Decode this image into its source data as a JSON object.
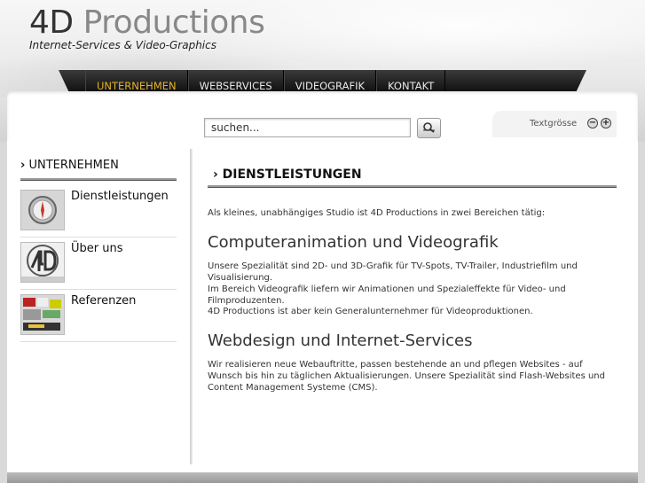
{
  "header": {
    "logo_4d": "4D",
    "logo_productions": "Productions",
    "tagline": "Internet-Services & Video-Graphics"
  },
  "nav": {
    "items": [
      {
        "label": "UNTERNEHMEN",
        "active": true
      },
      {
        "label": "WEBSERVICES"
      },
      {
        "label": "VIDEOGRAFIK"
      },
      {
        "label": "KONTAKT"
      }
    ],
    "active_color": "#e5b52a"
  },
  "search": {
    "value": "suchen...",
    "button_icon": "search-icon"
  },
  "textsize": {
    "label": "Textgrösse",
    "decrease": "−",
    "increase": "+"
  },
  "sidebar": {
    "title": "UNTERNEHMEN",
    "items": [
      {
        "label": "Dienstleistungen",
        "icon": "compass-icon"
      },
      {
        "label": "Über uns",
        "icon": "4d-logo-icon"
      },
      {
        "label": "Referenzen",
        "icon": "references-collage-icon"
      }
    ]
  },
  "main": {
    "title": "DIENSTLEISTUNGEN",
    "intro": "Als kleines, unabhängiges Studio ist 4D Productions in zwei Bereichen tätig:",
    "section1": {
      "heading": "Computeranimation und Videografik",
      "p1": "Unsere Spezialität sind 2D- und 3D-Grafik für TV-Spots, TV-Trailer, Industriefilm und Visualisierung.",
      "p2": "Im Bereich Videografik liefern wir Animationen und Spezialeffekte für Video- und Filmproduzenten.",
      "p3": "4D Productions ist aber kein Generalunternehmer für Videoproduktionen."
    },
    "section2": {
      "heading": "Webdesign und Internet-Services",
      "p1": "Wir realisieren neue Webauftritte, passen bestehende an und pflegen Websites - auf Wunsch bis hin zu täglichen Aktualisierungen. Unsere Spezialität sind Flash-Websites und Content Management Systeme (CMS)."
    }
  }
}
